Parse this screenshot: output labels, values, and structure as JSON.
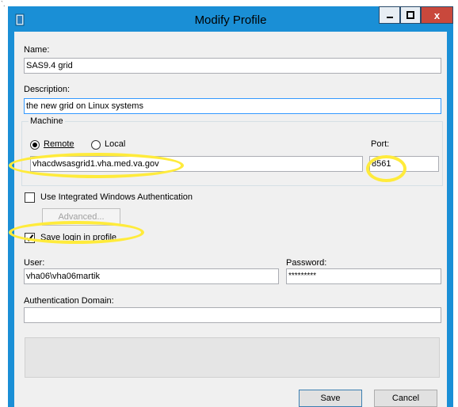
{
  "window": {
    "title": "Modify Profile",
    "close_glyph": "x"
  },
  "form": {
    "name_label": "Name:",
    "name_value": "SAS9.4 grid",
    "description_label": "Description:",
    "description_value": "the new grid on Linux systems",
    "machine_group_label": "Machine",
    "remote_label": "Remote",
    "local_label": "Local",
    "remote_selected": true,
    "host_value": "vhacdwsasgrid1.vha.med.va.gov",
    "port_label": "Port:",
    "port_value": "8561",
    "iwa_label": "Use Integrated Windows Authentication",
    "iwa_checked": false,
    "advanced_label": "Advanced...",
    "save_login_label": "Save login in profile",
    "save_login_checked": true,
    "user_label": "User:",
    "user_value": "vha06\\vha06martik",
    "password_label": "Password:",
    "password_value": "*********",
    "auth_domain_label": "Authentication Domain:",
    "auth_domain_value": ""
  },
  "buttons": {
    "save_label": "Save",
    "cancel_label": "Cancel"
  },
  "colors": {
    "titlebar": "#1a8fd6",
    "highlight": "#ffeb3b",
    "close_button": "#c9483c"
  }
}
